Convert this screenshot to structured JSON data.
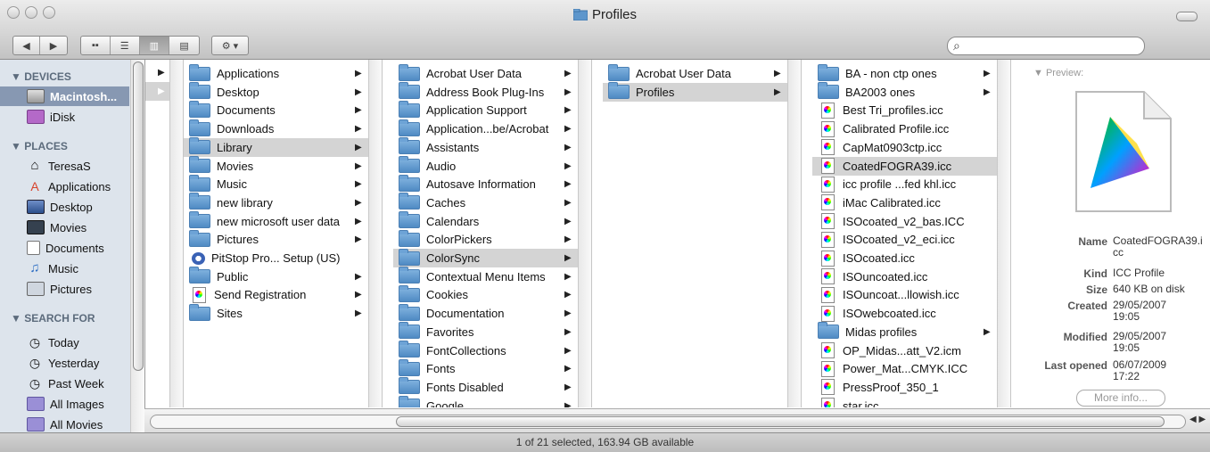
{
  "window": {
    "title": "Profiles"
  },
  "toolbar": {
    "back_label": "◀",
    "forward_label": "▶",
    "search_placeholder": ""
  },
  "sidebar": {
    "sections": [
      {
        "label": "▼ DEVICES",
        "items": [
          {
            "label": "Macintosh...",
            "icon": "hard-drive-icon",
            "selected": true
          },
          {
            "label": "iDisk",
            "icon": "idisk-icon"
          }
        ]
      },
      {
        "label": "▼ PLACES",
        "items": [
          {
            "label": "TeresaS",
            "icon": "home-icon"
          },
          {
            "label": "Applications",
            "icon": "applications-icon"
          },
          {
            "label": "Desktop",
            "icon": "desktop-icon"
          },
          {
            "label": "Movies",
            "icon": "movies-icon"
          },
          {
            "label": "Documents",
            "icon": "documents-icon"
          },
          {
            "label": "Music",
            "icon": "music-icon"
          },
          {
            "label": "Pictures",
            "icon": "pictures-icon"
          }
        ]
      },
      {
        "label": "▼ SEARCH FOR",
        "items": [
          {
            "label": "Today",
            "icon": "clock-icon"
          },
          {
            "label": "Yesterday",
            "icon": "clock-icon"
          },
          {
            "label": "Past Week",
            "icon": "clock-icon"
          },
          {
            "label": "All Images",
            "icon": "smart-folder-icon"
          },
          {
            "label": "All Movies",
            "icon": "smart-folder-icon"
          }
        ]
      }
    ]
  },
  "columns": {
    "col1": [
      {
        "label": "Applications",
        "icon": "folder-icon",
        "arrow": true
      },
      {
        "label": "Desktop",
        "icon": "folder-icon",
        "arrow": true
      },
      {
        "label": "Documents",
        "icon": "folder-icon",
        "arrow": true
      },
      {
        "label": "Downloads",
        "icon": "folder-icon",
        "arrow": true
      },
      {
        "label": "Library",
        "icon": "folder-icon",
        "arrow": true,
        "selected": true
      },
      {
        "label": "Movies",
        "icon": "folder-icon",
        "arrow": true
      },
      {
        "label": "Music",
        "icon": "folder-icon",
        "arrow": true
      },
      {
        "label": "new library",
        "icon": "folder-icon",
        "arrow": true
      },
      {
        "label": "new microsoft user data",
        "icon": "folder-icon",
        "arrow": true
      },
      {
        "label": "Pictures",
        "icon": "folder-icon",
        "arrow": true
      },
      {
        "label": "PitStop Pro... Setup (US)",
        "icon": "installer-icon",
        "arrow": false
      },
      {
        "label": "Public",
        "icon": "folder-icon",
        "arrow": true
      },
      {
        "label": "Send Registration",
        "icon": "document-icon",
        "arrow": true
      },
      {
        "label": "Sites",
        "icon": "folder-icon",
        "arrow": true
      }
    ],
    "col2": [
      {
        "label": "Acrobat User Data",
        "arrow": true
      },
      {
        "label": "Address Book Plug-Ins",
        "arrow": true
      },
      {
        "label": "Application Support",
        "arrow": true
      },
      {
        "label": "Application...be/Acrobat",
        "arrow": true
      },
      {
        "label": "Assistants",
        "arrow": true
      },
      {
        "label": "Audio",
        "arrow": true
      },
      {
        "label": "Autosave Information",
        "arrow": true
      },
      {
        "label": "Caches",
        "arrow": true
      },
      {
        "label": "Calendars",
        "arrow": true
      },
      {
        "label": "ColorPickers",
        "arrow": true
      },
      {
        "label": "ColorSync",
        "arrow": true,
        "selected": true
      },
      {
        "label": "Contextual Menu Items",
        "arrow": true
      },
      {
        "label": "Cookies",
        "arrow": true
      },
      {
        "label": "Documentation",
        "arrow": true
      },
      {
        "label": "Favorites",
        "arrow": true
      },
      {
        "label": "FontCollections",
        "arrow": true
      },
      {
        "label": "Fonts",
        "arrow": true
      },
      {
        "label": "Fonts Disabled",
        "arrow": true
      },
      {
        "label": "Google",
        "arrow": true
      }
    ],
    "col3": [
      {
        "label": "Acrobat User Data",
        "arrow": true
      },
      {
        "label": "Profiles",
        "arrow": true,
        "selected": true
      }
    ],
    "col4": [
      {
        "label": "BA - non ctp ones",
        "icon": "folder-icon",
        "arrow": true
      },
      {
        "label": "BA2003 ones",
        "icon": "folder-icon",
        "arrow": true
      },
      {
        "label": "Best Tri_profiles.icc",
        "icon": "icc-icon"
      },
      {
        "label": "Calibrated Profile.icc",
        "icon": "icc-icon"
      },
      {
        "label": "CapMat0903ctp.icc",
        "icon": "icc-icon"
      },
      {
        "label": "CoatedFOGRA39.icc",
        "icon": "icc-icon",
        "selected": true
      },
      {
        "label": "icc profile ...fed khl.icc",
        "icon": "icc-icon"
      },
      {
        "label": "iMac Calibrated.icc",
        "icon": "icc-icon"
      },
      {
        "label": "ISOcoated_v2_bas.ICC",
        "icon": "icc-icon"
      },
      {
        "label": "ISOcoated_v2_eci.icc",
        "icon": "icc-icon"
      },
      {
        "label": "ISOcoated.icc",
        "icon": "icc-icon"
      },
      {
        "label": "ISOuncoated.icc",
        "icon": "icc-icon"
      },
      {
        "label": "ISOuncoat...llowish.icc",
        "icon": "icc-icon"
      },
      {
        "label": "ISOwebcoated.icc",
        "icon": "icc-icon"
      },
      {
        "label": "Midas profiles",
        "icon": "folder-icon",
        "arrow": true
      },
      {
        "label": "OP_Midas...att_V2.icm",
        "icon": "icc-icon"
      },
      {
        "label": "Power_Mat...CMYK.ICC",
        "icon": "icc-icon"
      },
      {
        "label": "PressProof_350_1",
        "icon": "icc-icon"
      },
      {
        "label": "star.icc",
        "icon": "icc-icon"
      }
    ]
  },
  "preview": {
    "label": "▼ Preview:",
    "name_key": "Name",
    "name_value": "CoatedFOGRA39.icc",
    "kind_key": "Kind",
    "kind_value": "ICC Profile",
    "size_key": "Size",
    "size_value": "640 KB on disk",
    "created_key": "Created",
    "created_value": "29/05/2007 19:05",
    "modified_key": "Modified",
    "modified_value": "29/05/2007 19:05",
    "opened_key": "Last opened",
    "opened_value": "06/07/2009 17:22",
    "more_info": "More info..."
  },
  "status": {
    "text": "1 of 21 selected, 163.94 GB available"
  }
}
